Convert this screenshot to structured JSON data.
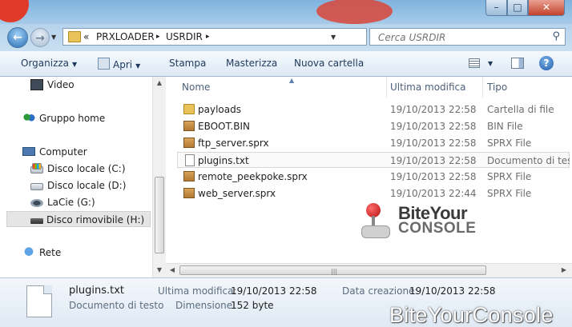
{
  "window": {
    "controls": {
      "minimize": "–",
      "maximize": "□",
      "close": "✕"
    }
  },
  "address": {
    "overflow": "«",
    "crumbs": [
      "PRXLOADER",
      "USRDIR"
    ],
    "separator": "▸",
    "refresh_icon": "refresh-icon",
    "search_placeholder": "Cerca USRDIR"
  },
  "toolbar": {
    "organize": "Organizza",
    "open": "Apri",
    "print": "Stampa",
    "burn": "Masterizza",
    "new_folder": "Nuova cartella",
    "help": "?"
  },
  "nav": {
    "items": [
      {
        "label": "Video",
        "icon": "video-icon"
      },
      {
        "label": "Gruppo home",
        "icon": "homegroup-icon"
      },
      {
        "label": "Computer",
        "icon": "computer-icon"
      },
      {
        "label": "Disco locale (C:)",
        "icon": "drive-c-icon"
      },
      {
        "label": "Disco locale (D:)",
        "icon": "drive-d-icon"
      },
      {
        "label": "LaCie (G:)",
        "icon": "lacie-drive-icon"
      },
      {
        "label": "Disco rimovibile (H:)",
        "icon": "removable-drive-icon",
        "selected": true
      },
      {
        "label": "Rete",
        "icon": "network-icon"
      }
    ]
  },
  "columns": {
    "name": "Nome",
    "modified": "Ultima modifica",
    "type": "Tipo"
  },
  "files": [
    {
      "name": "payloads",
      "modified": "19/10/2013 22:58",
      "type": "Cartella di file",
      "icon": "folder-icon"
    },
    {
      "name": "EBOOT.BIN",
      "modified": "19/10/2013 22:58",
      "type": "BIN File",
      "icon": "package-icon"
    },
    {
      "name": "ftp_server.sprx",
      "modified": "19/10/2013 22:58",
      "type": "SPRX File",
      "icon": "package-icon"
    },
    {
      "name": "plugins.txt",
      "modified": "19/10/2013 22:58",
      "type": "Documento di testo",
      "icon": "text-document-icon"
    },
    {
      "name": "remote_peekpoke.sprx",
      "modified": "19/10/2013 22:58",
      "type": "SPRX File",
      "icon": "package-icon"
    },
    {
      "name": "web_server.sprx",
      "modified": "19/10/2013 22:44",
      "type": "SPRX File",
      "icon": "package-icon"
    }
  ],
  "logo": {
    "line1": "BiteYour",
    "line2": "CONSOLE"
  },
  "details": {
    "filename": "plugins.txt",
    "filetype": "Documento di testo",
    "modified_label": "Ultima modifica:",
    "modified_value": "19/10/2013 22:58",
    "size_label": "Dimensione:",
    "size_value": "152 byte",
    "created_label": "Data creazione:",
    "created_value": "19/10/2013 22:58"
  },
  "watermark": "BiteYourConsole"
}
